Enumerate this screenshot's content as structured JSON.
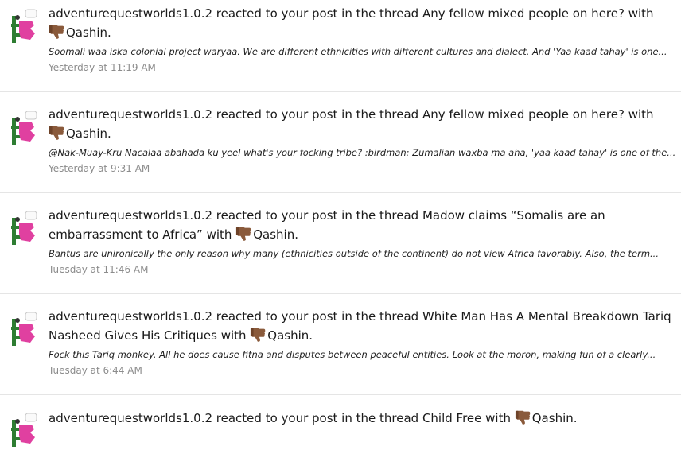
{
  "alerts": [
    {
      "username": "adventurequestworlds1.0.2",
      "action_text": " reacted to your post in the thread ",
      "thread_title": "Any fellow mixed people on here?",
      "with_text": " with ",
      "reaction_name": "Qashin",
      "reaction_icon": "thumbs-down-icon",
      "snippet": "Soomali waa iska colonial project waryaa. We are different ethnicities with different cultures and dialect. And 'Yaa kaad tahay' is one...",
      "timestamp": "Yesterday at 11:19 AM"
    },
    {
      "username": "adventurequestworlds1.0.2",
      "action_text": " reacted to your post in the thread ",
      "thread_title": "Any fellow mixed people on here?",
      "with_text": " with ",
      "reaction_name": "Qashin",
      "reaction_icon": "thumbs-down-icon",
      "snippet": "@Nak-Muay-Kru Nacalaa abahada ku yeel what's your focking tribe? :birdman: Zumalian waxba ma aha, 'yaa kaad tahay' is one of the...",
      "timestamp": "Yesterday at 9:31 AM"
    },
    {
      "username": "adventurequestworlds1.0.2",
      "action_text": " reacted to your post in the thread ",
      "thread_title": "Madow claims “Somalis are an embarrassment to Africa”",
      "with_text": " with ",
      "reaction_name": "Qashin",
      "reaction_icon": "thumbs-down-icon",
      "snippet": "Bantus are unironically the only reason why many (ethnicities outside of the continent) do not view Africa favorably. Also, the term...",
      "timestamp": "Tuesday at 11:46 AM"
    },
    {
      "username": "adventurequestworlds1.0.2",
      "action_text": " reacted to your post in the thread ",
      "thread_title": "White Man Has A Mental Breakdown Tariq Nasheed Gives His Critiques",
      "with_text": " with ",
      "reaction_name": "Qashin",
      "reaction_icon": "thumbs-down-icon",
      "snippet": "Fock this Tariq monkey. All he does cause fitna and disputes between peaceful entities. Look at the moron, making fun of a clearly...",
      "timestamp": "Tuesday at 6:44 AM"
    },
    {
      "username": "adventurequestworlds1.0.2",
      "action_text": " reacted to your post in the thread ",
      "thread_title": "Child Free",
      "with_text": " with ",
      "reaction_name": "Qashin",
      "reaction_icon": "thumbs-down-icon",
      "snippet": "",
      "timestamp": ""
    }
  ],
  "colors": {
    "text": "#1a1a1a",
    "timestamp": "#8c8c8c",
    "divider": "#e5e5e5",
    "avatar_green": "#2e7d32",
    "avatar_pink": "#e040a0",
    "reaction_brown": "#8a5a3b"
  }
}
